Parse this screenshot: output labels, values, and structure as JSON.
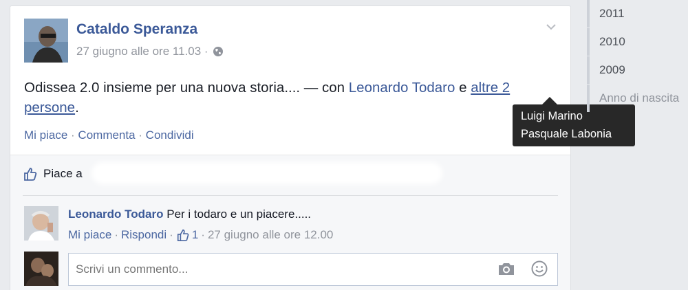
{
  "post": {
    "author": "Cataldo Speranza",
    "timestamp": "27 giugno alle ore 11.03 ·",
    "text_main": "Odissea 2.0 insieme per una nuova storia.... — con ",
    "tagged_person": "Leonardo Todaro",
    "conj": " e ",
    "others_link": "altre 2 persone",
    "period": ".",
    "actions": {
      "like": "Mi piace",
      "sep1": " · ",
      "comment": "Commenta",
      "sep2": " · ",
      "share": "Condividi"
    }
  },
  "tooltip": {
    "names": [
      "Luigi Marino",
      "Pasquale Labonia"
    ]
  },
  "ufi": {
    "likes_label": "Piace a",
    "comment": {
      "author": "Leonardo Todaro",
      "text": " Per i todaro e un piacere.....",
      "like": "Mi piace",
      "sep1": " · ",
      "reply": "Rispondi",
      "sep2": " · ",
      "like_count": "1",
      "sep3": " · ",
      "timestamp": "27 giugno alle ore 12.00"
    },
    "input_placeholder": "Scrivi un commento..."
  },
  "timeline": {
    "items": [
      "2011",
      "2010",
      "2009",
      "Anno di nascita"
    ]
  },
  "colors": {
    "link": "#3b5998",
    "meta": "#90949c",
    "tooltip_bg": "#282828"
  },
  "icons": [
    "globe-icon",
    "chevron-down-icon",
    "thumbs-up-icon",
    "camera-icon",
    "smiley-icon"
  ]
}
